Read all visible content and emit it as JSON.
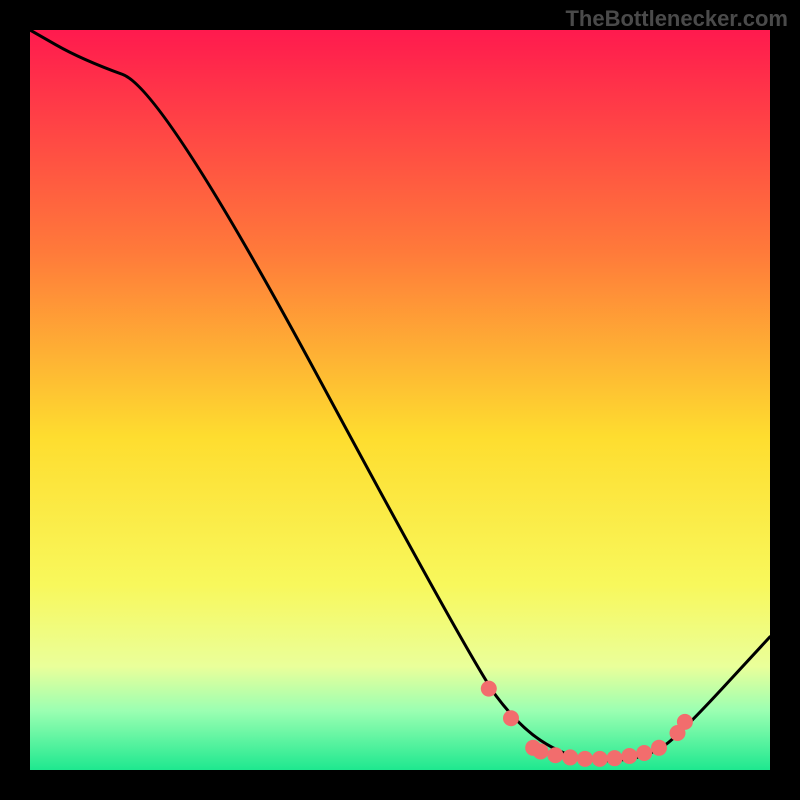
{
  "watermark": "TheBottlenecker.com",
  "chart_data": {
    "type": "line",
    "title": "",
    "xlabel": "",
    "ylabel": "",
    "xlim": [
      0,
      100
    ],
    "ylim": [
      0,
      100
    ],
    "background_gradient_stops": [
      {
        "offset": 0,
        "color": "#ff1a4e"
      },
      {
        "offset": 30,
        "color": "#ff7a3a"
      },
      {
        "offset": 55,
        "color": "#fedd2f"
      },
      {
        "offset": 75,
        "color": "#f8f85c"
      },
      {
        "offset": 86,
        "color": "#eaff9a"
      },
      {
        "offset": 92,
        "color": "#9bffb2"
      },
      {
        "offset": 100,
        "color": "#1ee88f"
      }
    ],
    "series": [
      {
        "name": "curve",
        "x": [
          0,
          7,
          18,
          60,
          66,
          72,
          78,
          84,
          88,
          100
        ],
        "y": [
          100,
          96,
          92,
          14,
          6,
          2,
          1,
          2,
          5,
          18
        ]
      }
    ],
    "markers": [
      {
        "x": 62,
        "y": 11
      },
      {
        "x": 65,
        "y": 7
      },
      {
        "x": 68,
        "y": 3
      },
      {
        "x": 69,
        "y": 2.5
      },
      {
        "x": 71,
        "y": 2
      },
      {
        "x": 73,
        "y": 1.7
      },
      {
        "x": 75,
        "y": 1.5
      },
      {
        "x": 77,
        "y": 1.5
      },
      {
        "x": 79,
        "y": 1.6
      },
      {
        "x": 81,
        "y": 1.9
      },
      {
        "x": 83,
        "y": 2.3
      },
      {
        "x": 85,
        "y": 3
      },
      {
        "x": 87.5,
        "y": 5
      },
      {
        "x": 88.5,
        "y": 6.5
      }
    ],
    "marker_color": "#f26d6d"
  }
}
